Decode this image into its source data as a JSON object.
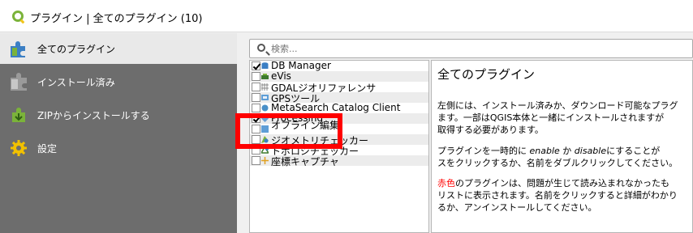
{
  "window": {
    "title": "プラグイン | 全てのプラグイン (10)"
  },
  "sidebar": {
    "items": [
      {
        "label": "全てのプラグイン",
        "icon": "puzzle-icon",
        "selected": true
      },
      {
        "label": "インストール済み",
        "icon": "puzzle-installed-icon",
        "selected": false
      },
      {
        "label": "ZIPからインストールする",
        "icon": "zip-install-icon",
        "selected": false
      },
      {
        "label": "設定",
        "icon": "gear-icon",
        "selected": false
      }
    ]
  },
  "search": {
    "placeholder": "検索..."
  },
  "plugins": [
    {
      "name": "DB Manager",
      "checked": true,
      "icon": "database-icon"
    },
    {
      "name": "eVis",
      "checked": false,
      "icon": "evis-icon"
    },
    {
      "name": "GDALジオリファレンサ",
      "checked": false,
      "icon": "georeferencer-icon"
    },
    {
      "name": "GPSツール",
      "checked": false,
      "icon": "gps-icon"
    },
    {
      "name": "MetaSearch Catalog Client",
      "checked": false,
      "icon": "metasearch-icon"
    },
    {
      "name": "Processing",
      "checked": true,
      "icon": "processing-icon"
    },
    {
      "name": "オフライン編集",
      "checked": false,
      "icon": "offline-edit-icon"
    },
    {
      "name": "ジオメトリチェッカー",
      "checked": false,
      "icon": "geometry-checker-icon"
    },
    {
      "name": "トポロジチェッカー",
      "checked": false,
      "icon": "topology-checker-icon"
    },
    {
      "name": "座標キャプチャ",
      "checked": false,
      "icon": "coordinate-capture-icon"
    }
  ],
  "description": {
    "heading": "全てのプラグイン",
    "p1_line1": "左側には、インストール済みか、ダウンロード可能なプラグ",
    "p1_line2": "ます。一部はQGIS本体と一緒にインストールされますが",
    "p1_line3": "取得する必要があります。",
    "p2_line1_a": "プラグインを一時的に ",
    "p2_line1_enable": "enable",
    "p2_line1_b": " か ",
    "p2_line1_disable": "disable",
    "p2_line1_c": "にすることが",
    "p2_line2": "スをクリックするか、名前をダブルクリックしてください。",
    "p3_line1_red": "赤色",
    "p3_line1_rest": "のプラグインは、問題が生じて読み込まれなかったも",
    "p3_line2": "リストに表示されます。名前をクリックすると詳細がわかり",
    "p3_line3": "るか、アンインストールしてください。",
    "red_color": "#ff0000"
  },
  "annotation": {
    "color": "#ff0000"
  }
}
